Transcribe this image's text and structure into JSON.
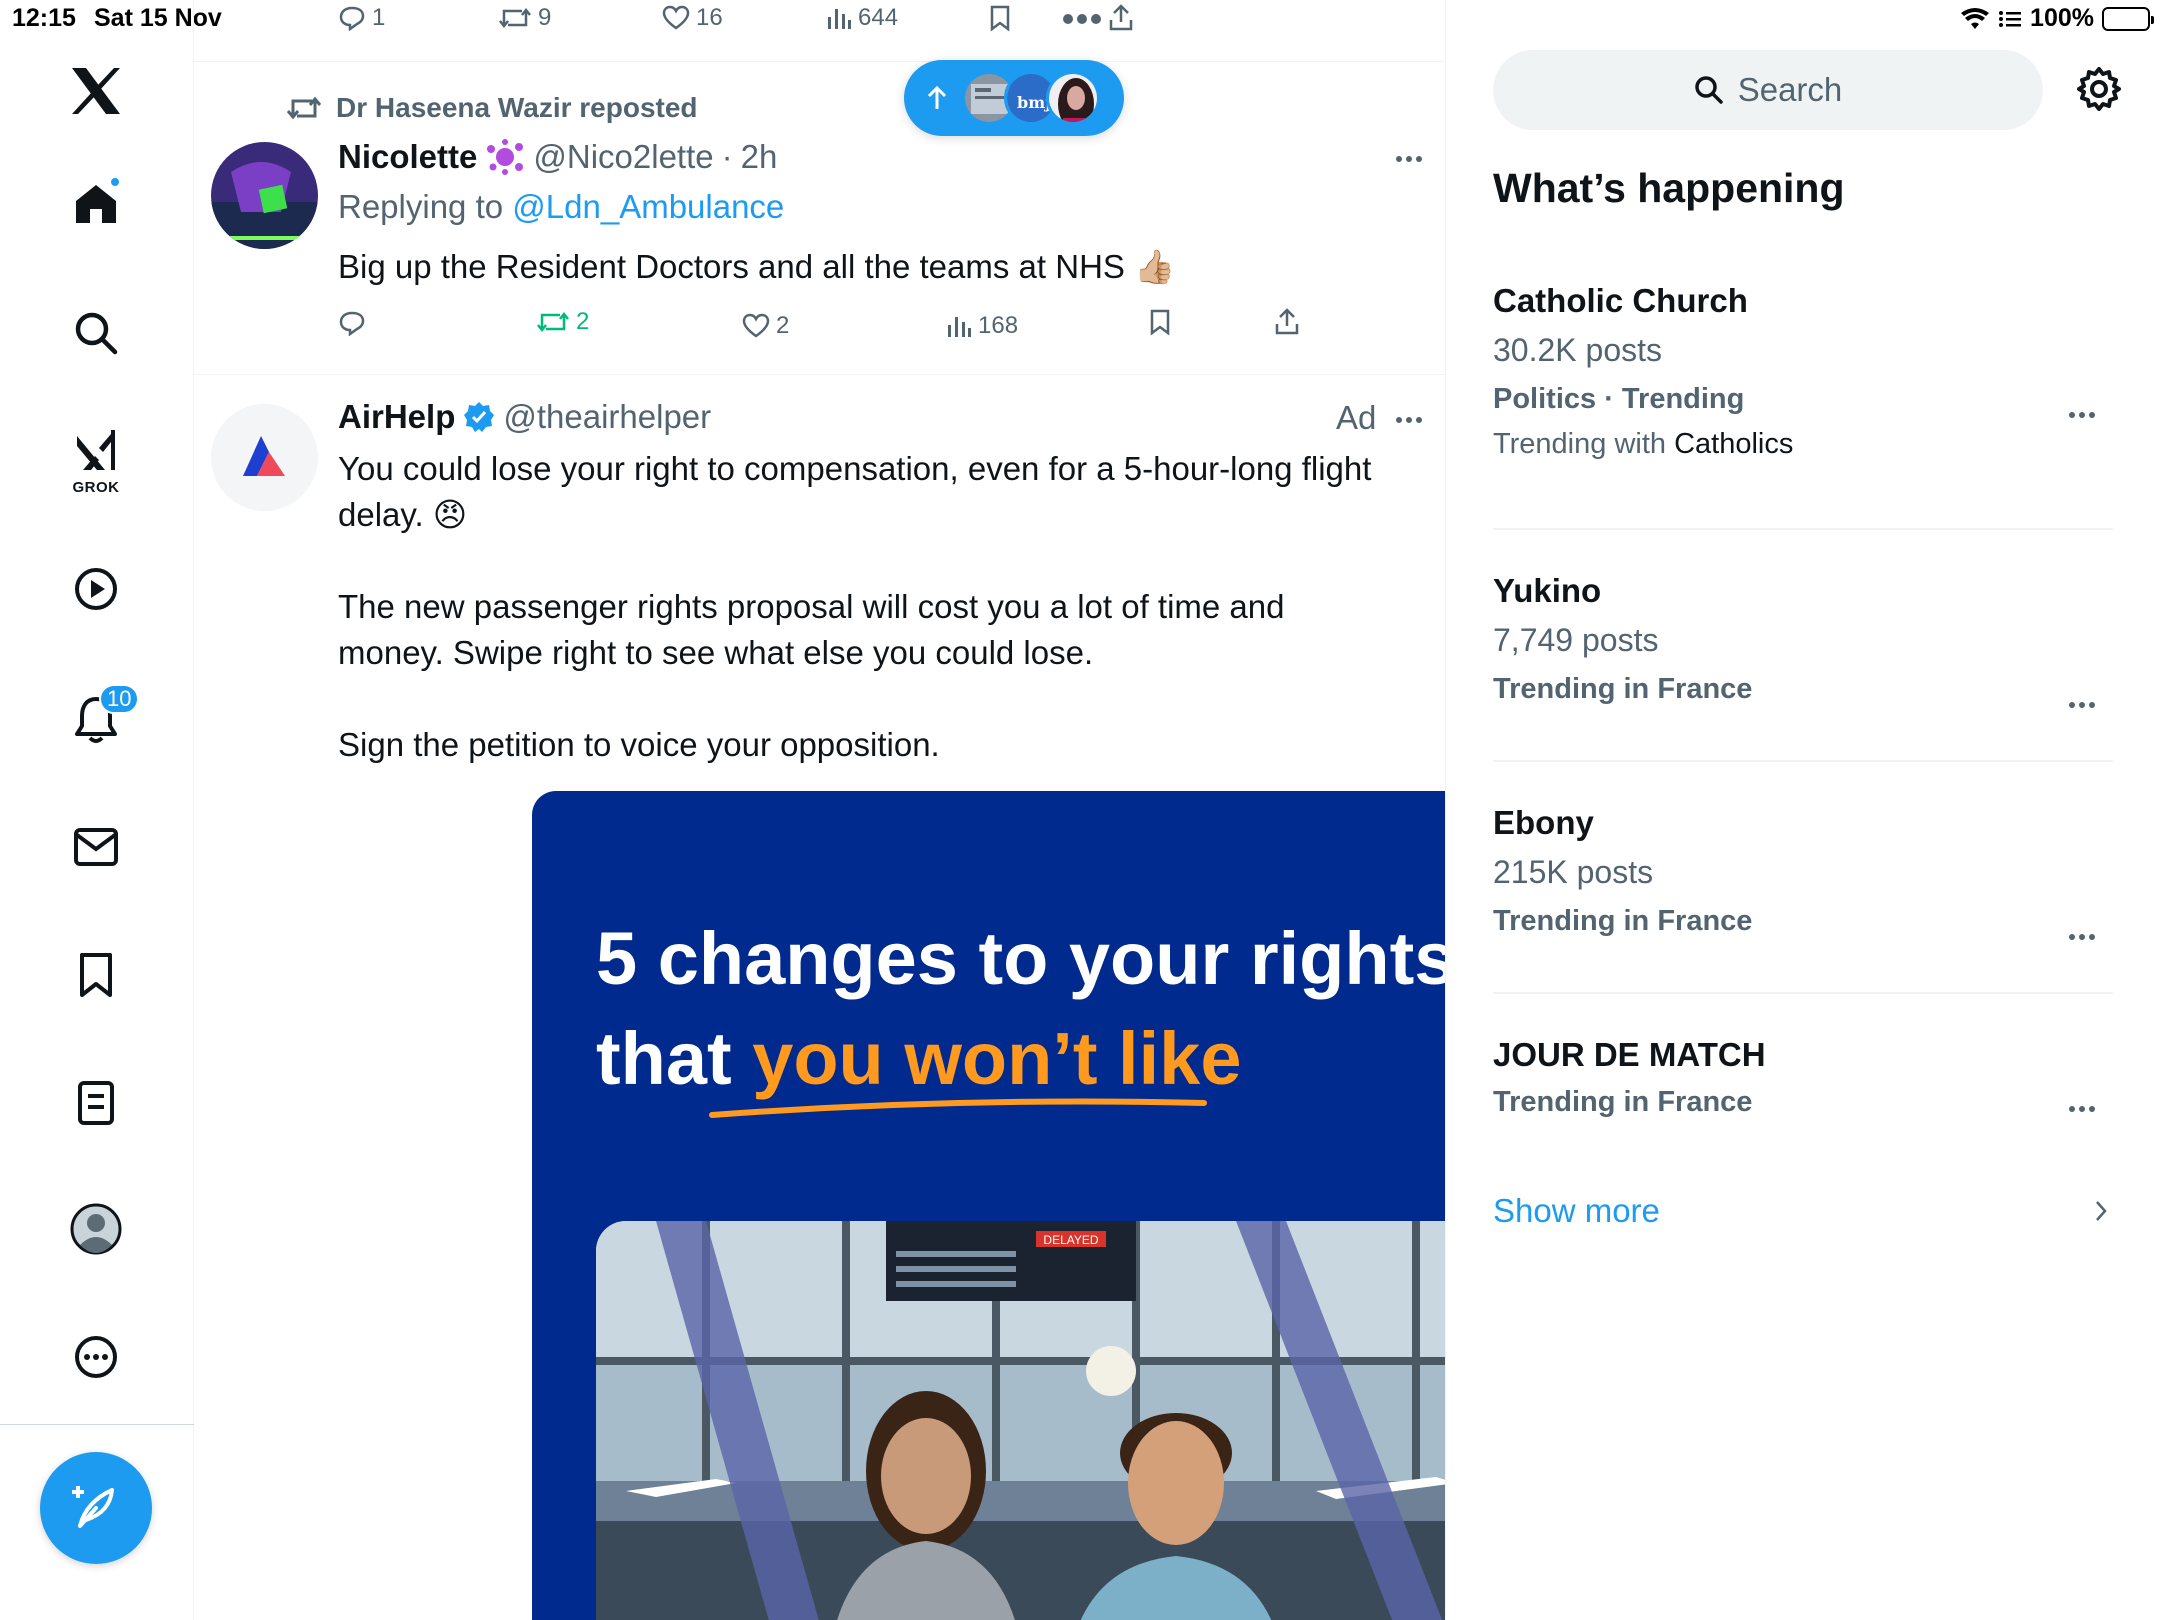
{
  "status_bar": {
    "time": "12:15",
    "date": "Sat 15 Nov",
    "battery": "100%"
  },
  "nav": {
    "grok_label": "GROK",
    "notifications_count": "10"
  },
  "top_actions": {
    "replies": "1",
    "reposts": "9",
    "likes": "16",
    "views": "644"
  },
  "reply_tweet": {
    "repost_by": "Dr Haseena Wazir reposted",
    "name": "Nicolette",
    "handle": "@Nico2lette",
    "dot": "·",
    "time": "2h",
    "replying_to_label": "Replying to",
    "replying_to_handle": "@Ldn_Ambulance",
    "text": "Big up the Resident Doctors and all the teams at NHS",
    "text_emoji": "👍🏼",
    "reposts": "2",
    "likes": "2",
    "views": "168"
  },
  "pill": {
    "bmj_label": "bmj"
  },
  "ad_tweet": {
    "name": "AirHelp",
    "handle": "@theairhelper",
    "ad_label": "Ad",
    "line1": "You could lose your right to compensation, even for a 5-hour-long flight delay.",
    "emoji": "😠",
    "line2": "The new passenger rights proposal will cost you a lot of time and money. Swipe right to see what else you could lose.",
    "line3": "Sign the petition to voice your opposition.",
    "card_title_line1": "5 changes to your rights",
    "card_title_line2_a": "that ",
    "card_title_line2_b": "you won’t like",
    "board_label": "DELAYED"
  },
  "sidebar": {
    "search_placeholder": "Search",
    "whats_happening": "What’s happening",
    "trends": [
      {
        "name": "Catholic Church",
        "posts": "30.2K posts",
        "context": "Politics · Trending",
        "with_label": "Trending with",
        "with_value": "Catholics"
      },
      {
        "name": "Yukino",
        "posts": "7,749 posts",
        "context": "Trending in France"
      },
      {
        "name": "Ebony",
        "posts": "215K posts",
        "context": "Trending in France"
      },
      {
        "name": "JOUR DE MATCH",
        "context": "Trending in France"
      }
    ],
    "show_more": "Show more"
  },
  "colors": {
    "accent": "#1d9bf0",
    "repost_green": "#00ba7c",
    "card_blue": "#002a8d",
    "card_orange": "#ff9a1f"
  }
}
